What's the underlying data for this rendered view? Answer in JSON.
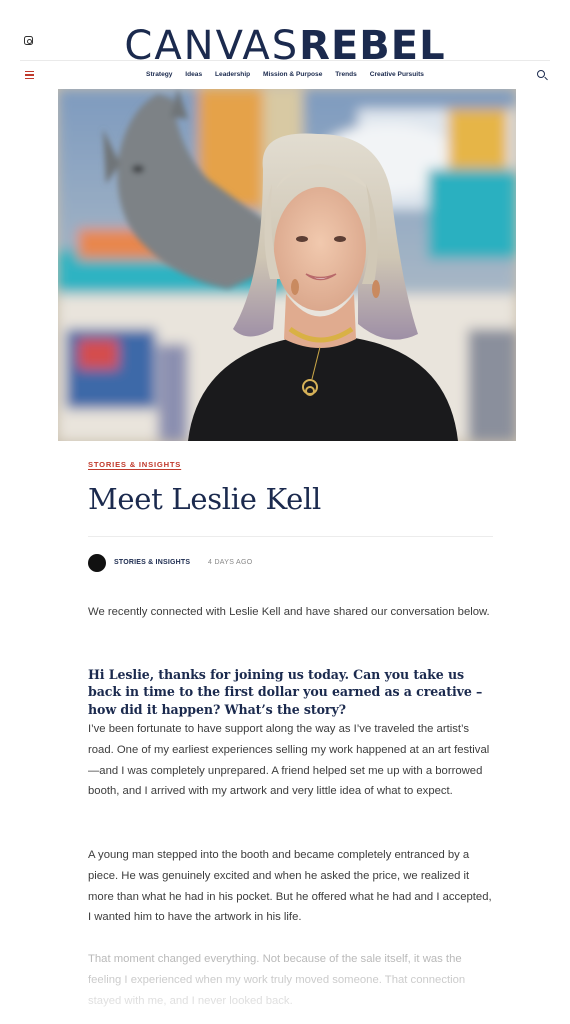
{
  "site": {
    "logo_light": "CANVAS",
    "logo_bold": "REBEL",
    "icons": {
      "social": "instagram-icon",
      "menu": "hamburger-menu-icon",
      "search": "search-icon"
    },
    "nav": [
      "Strategy",
      "Ideas",
      "Leadership",
      "Mission & Purpose",
      "Trends",
      "Creative Pursuits"
    ]
  },
  "colors": {
    "navy": "#1b2a4e",
    "accent_red": "#c0392b"
  },
  "article": {
    "category": "STORIES & INSIGHTS",
    "title": "Meet Leslie Kell",
    "byline": {
      "author": "STORIES & INSIGHTS",
      "date": "4 DAYS AGO"
    },
    "intro": "We recently connected with Leslie Kell and have shared our conversation below.",
    "question": "Hi Leslie, thanks for joining us today. Can you take us back in time to the first dollar you earned as a creative – how did it happen? What’s the story?",
    "paragraphs": [
      "I’ve been fortunate to have support along the way as I’ve traveled the artist’s road. One of my earliest experiences selling my work happened at an art festival—and I was completely unprepared. A friend helped set me up with a borrowed booth, and I arrived with my artwork and very little idea of what to expect.",
      "A young man stepped into the booth and became completely entranced by a piece. He was genuinely excited and when he asked the price, we realized it more than what he had in his pocket. But he offered what he had and I accepted, I wanted him to have the artwork in his life.",
      "That moment changed everything. Not because of the sale itself, it was the feeling I experienced when my work truly moved someone. That connection stayed with me, and I never looked back."
    ]
  }
}
